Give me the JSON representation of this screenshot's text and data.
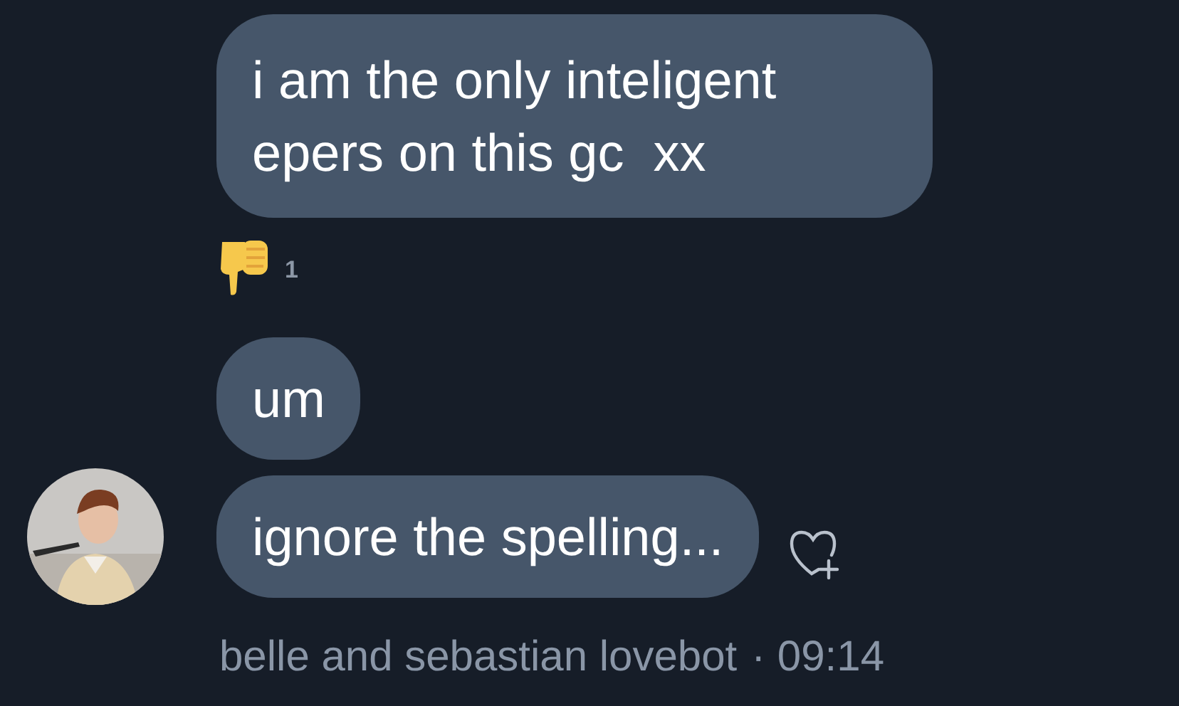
{
  "messages": [
    {
      "text": "i am the only inteligent epers on this gc  xx",
      "reaction": {
        "count": "1"
      }
    },
    {
      "text": "um"
    },
    {
      "text": "ignore the spelling...",
      "avatar": true,
      "like_button": true
    }
  ],
  "footer": {
    "sender": "belle and sebastian lovebot",
    "time": "· 09:14"
  }
}
